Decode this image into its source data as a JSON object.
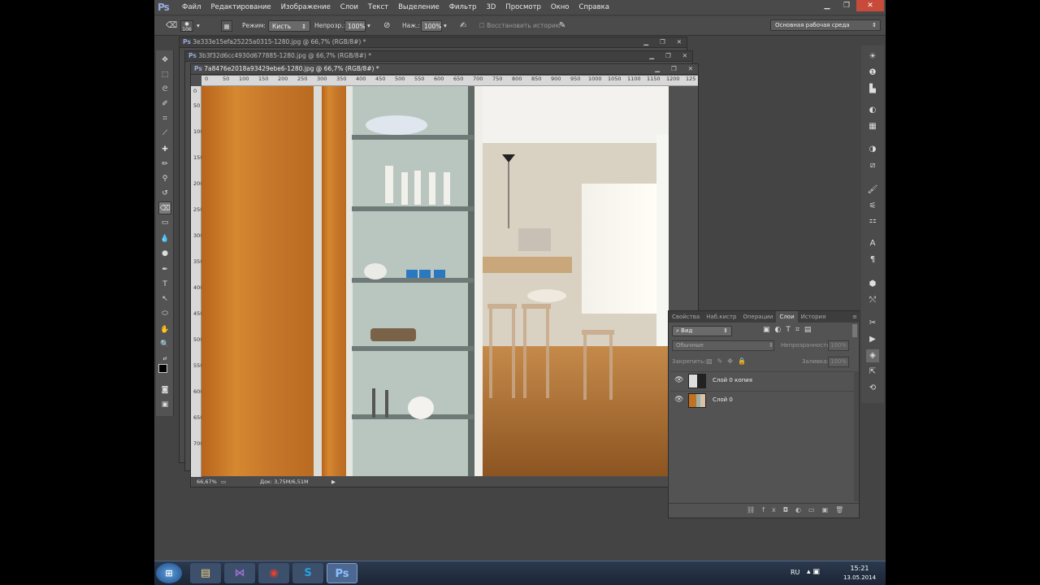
{
  "app": {
    "logo": "Ps"
  },
  "menu": [
    "Файл",
    "Редактирование",
    "Изображение",
    "Слои",
    "Текст",
    "Выделение",
    "Фильтр",
    "3D",
    "Просмотр",
    "Окно",
    "Справка"
  ],
  "window_buttons": {
    "minimize": "▁",
    "restore": "❐",
    "close": "✕"
  },
  "options": {
    "brush_size": "106",
    "mode_label": "Режим:",
    "mode_value": "Кисть",
    "opacity_label": "Непрозр.:",
    "opacity_value": "100%",
    "flow_label": "Наж.:",
    "flow_value": "100%",
    "restore_history": "Восстановить историю"
  },
  "workspace": "Основная рабочая среда",
  "documents": [
    {
      "title": "3e333e15efa25225a0315-1280.jpg @ 66,7% (RGB/8#) *"
    },
    {
      "title": "3b3f32d6cc4930d677885-1280.jpg @ 66,7% (RGB/8#) *"
    },
    {
      "title": "7a8476e2018a93429ebe6-1280.jpg @ 66,7% (RGB/8#) *"
    }
  ],
  "ruler_top": [
    "0",
    "50",
    "100",
    "150",
    "200",
    "250",
    "300",
    "350",
    "400",
    "450",
    "500",
    "550",
    "600",
    "650",
    "700",
    "750",
    "800",
    "850",
    "900",
    "950",
    "1000",
    "1050",
    "1100",
    "1150",
    "1200",
    "125"
  ],
  "ruler_left": [
    "0",
    "50",
    "100",
    "150",
    "200",
    "250",
    "300",
    "350",
    "400",
    "450",
    "500",
    "550",
    "600",
    "650",
    "700"
  ],
  "status": {
    "zoom": "66,67%",
    "doc": "Док: 3,75M/6,51M"
  },
  "tools": [
    "move",
    "marquee",
    "lasso",
    "quick-select",
    "crop",
    "eyedropper",
    "healing",
    "brush",
    "stamp",
    "history-brush",
    "eraser",
    "gradient",
    "blur",
    "dodge",
    "pen",
    "type",
    "path-select",
    "shape",
    "hand",
    "zoom"
  ],
  "layers_panel": {
    "tabs": [
      "Свойства",
      "Наб.кистр",
      "Операции",
      "Слои",
      "История"
    ],
    "active_tab": "Слои",
    "filter": "Вид",
    "blend_mode": "Обычные",
    "opacity_label": "Непрозрачность:",
    "opacity_value": "100%",
    "lock_label": "Закрепить:",
    "fill_label": "Заливка:",
    "fill_value": "100%",
    "layers": [
      {
        "name": "Слой 0 копия",
        "visible": true,
        "selected": false
      },
      {
        "name": "Слой 0",
        "visible": true,
        "selected": false
      }
    ]
  },
  "taskbar": {
    "lang": "RU",
    "time": "15:21",
    "date": "13.05.2014",
    "apps": [
      "start",
      "explorer",
      "visual-studio",
      "chrome",
      "skype",
      "photoshop"
    ]
  }
}
